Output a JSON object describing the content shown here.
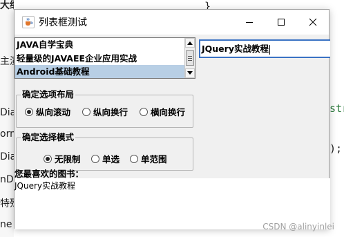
{
  "background": {
    "left_fragments": [
      "大纲",
      "主演",
      "Dia",
      "orml",
      "Dia",
      "nDu",
      "特殊",
      "ne"
    ],
    "code_fragments": [
      "}",
      "str",
      ");"
    ]
  },
  "window": {
    "title": "列表框测试",
    "app_icon": "java-coffee-icon",
    "controls": [
      "minimize-icon",
      "maximize-icon",
      "close-icon"
    ]
  },
  "book_list": {
    "items": [
      "JAVA自学宝典",
      "轻量级的JAVAEE企业应用实战",
      "Android基础教程"
    ],
    "selected_index": 2
  },
  "text_field": {
    "value": "JQuery实战教程"
  },
  "layout_group": {
    "title": "确定选项布局",
    "options": [
      "纵向滚动",
      "纵向换行",
      "横向换行"
    ],
    "selected_index": 0
  },
  "mode_group": {
    "title": "确定选择模式",
    "options": [
      "无限制",
      "单选",
      "单范围"
    ],
    "selected_index": 0
  },
  "favorite": {
    "label": "您最喜欢的图书：",
    "value": "JQuery实战教程"
  },
  "watermark": "CSDN @alinyinlei",
  "colors": {
    "selection": "#b8cfe5",
    "focus_border": "#3a72c4",
    "code_green": "#2a7a3b"
  }
}
